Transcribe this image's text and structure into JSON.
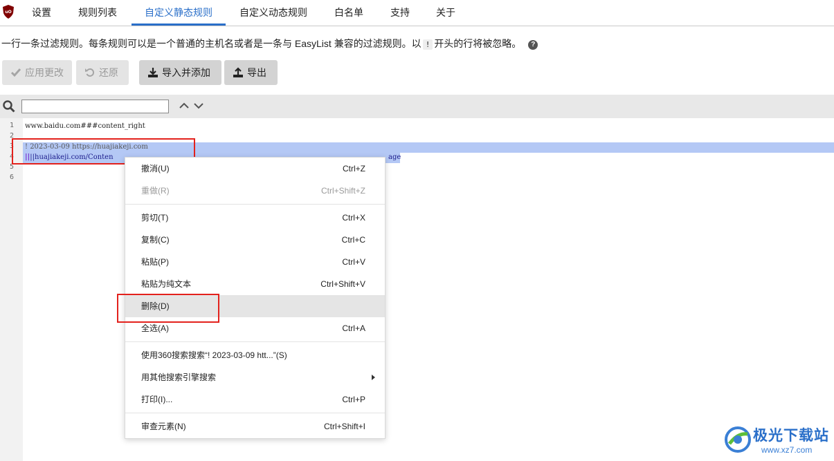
{
  "nav": {
    "tabs": [
      {
        "label": "设置"
      },
      {
        "label": "规则列表"
      },
      {
        "label": "自定义静态规则",
        "active": true
      },
      {
        "label": "自定义动态规则"
      },
      {
        "label": "白名单"
      },
      {
        "label": "支持"
      },
      {
        "label": "关于"
      }
    ],
    "logo_icon": "ublock-shield-icon"
  },
  "description": {
    "text_before": "一行一条过滤规则。每条规则可以是一个普通的主机名或者是一条与 EasyList 兼容的过滤规则。以",
    "code": "!",
    "text_after": "开头的行将被忽略。",
    "help_glyph": "?"
  },
  "toolbar": {
    "apply_label": "应用更改",
    "revert_label": "还原",
    "import_label": "导入并添加",
    "export_label": "导出"
  },
  "search": {
    "value": ""
  },
  "editor": {
    "line_numbers": [
      "1",
      "2",
      "3",
      "4",
      "5",
      "6"
    ],
    "lines": [
      "www.baidu.com###content_right",
      "",
      "! 2023-03-09 https://huajiakeji.com",
      "||huajiakeji.com/Conten",
      "",
      ""
    ],
    "line4_tail": "age"
  },
  "context_menu": {
    "items": [
      {
        "label": "撤消(U)",
        "shortcut": "Ctrl+Z"
      },
      {
        "label": "重做(R)",
        "shortcut": "Ctrl+Shift+Z",
        "disabled": true
      },
      {
        "label": "剪切(T)",
        "shortcut": "Ctrl+X"
      },
      {
        "label": "复制(C)",
        "shortcut": "Ctrl+C"
      },
      {
        "label": "粘贴(P)",
        "shortcut": "Ctrl+V"
      },
      {
        "label": "粘贴为纯文本",
        "shortcut": "Ctrl+Shift+V"
      },
      {
        "label": "删除(D)",
        "shortcut": "",
        "highlighted": true
      },
      {
        "label": "全选(A)",
        "shortcut": "Ctrl+A"
      },
      {
        "label": "使用360搜索搜索“! 2023-03-09 htt...”(S)",
        "shortcut": ""
      },
      {
        "label": "用其他搜索引擎搜索",
        "shortcut": "",
        "submenu": true
      },
      {
        "label": "打印(I)...",
        "shortcut": "Ctrl+P"
      },
      {
        "label": "审查元素(N)",
        "shortcut": "Ctrl+Shift+I"
      }
    ]
  },
  "watermark": {
    "text": "极光下载站",
    "url": "www.xz7.com"
  },
  "colors": {
    "accent": "#2a6fc9",
    "selection": "#b4c8f5",
    "annotation": "#e3211c"
  }
}
